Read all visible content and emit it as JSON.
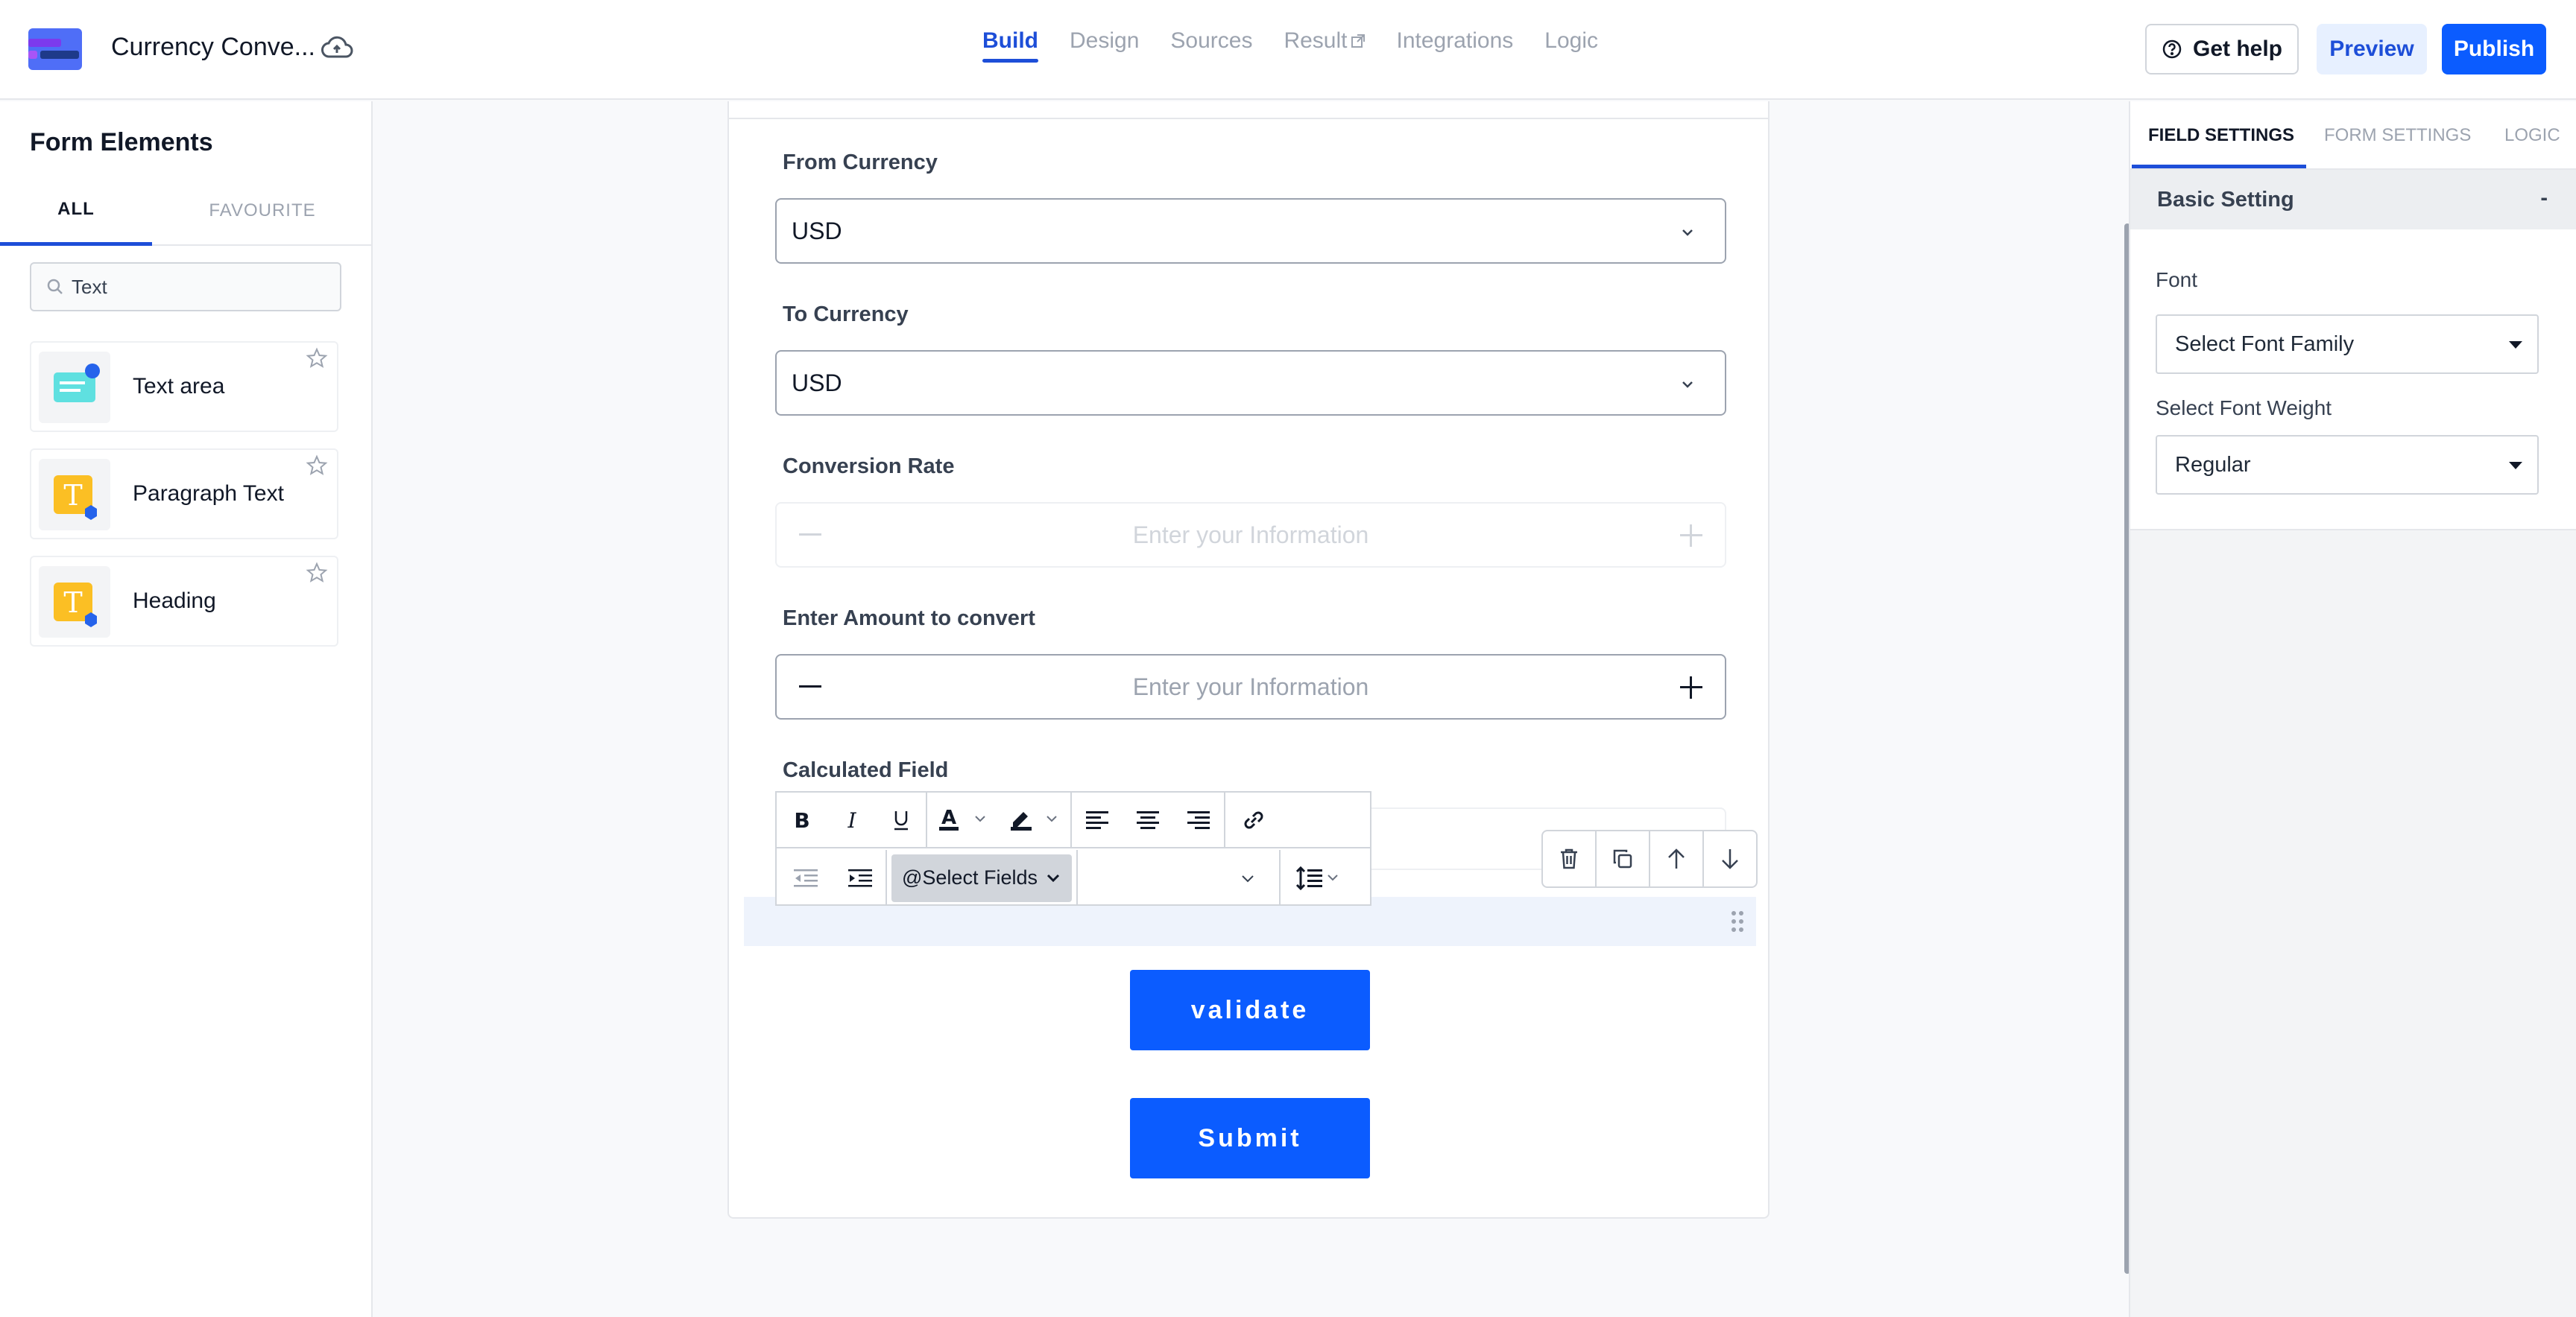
{
  "header": {
    "app_title": "Currency Conve...",
    "nav": [
      {
        "label": "Build",
        "active": true
      },
      {
        "label": "Design"
      },
      {
        "label": "Sources"
      },
      {
        "label": "Result"
      },
      {
        "label": "Integrations"
      },
      {
        "label": "Logic"
      }
    ],
    "get_help": "Get help",
    "preview": "Preview",
    "publish": "Publish",
    "accent_color": "#0b5cff"
  },
  "left_panel": {
    "title": "Form Elements",
    "tabs": [
      "ALL",
      "FAVOURITE"
    ],
    "search_value": "Text",
    "elements": [
      {
        "label": "Text area",
        "icon": "text-area-icon"
      },
      {
        "label": "Paragraph Text",
        "icon": "paragraph-text-icon"
      },
      {
        "label": "Heading",
        "icon": "heading-icon"
      }
    ]
  },
  "form": {
    "from_currency_label": "From Currency",
    "from_currency_value": "USD",
    "to_currency_label": "To Currency",
    "to_currency_value": "USD",
    "conversion_rate_label": "Conversion Rate",
    "conversion_rate_placeholder": "Enter your Information",
    "amount_label": "Enter Amount to convert",
    "amount_placeholder": "Enter your Information",
    "calculated_label": "Calculated Field",
    "select_fields": "@Select Fields",
    "validate": "validate",
    "submit": "Submit"
  },
  "right_panel": {
    "tabs": [
      "FIELD SETTINGS",
      "FORM SETTINGS",
      "LOGIC"
    ],
    "section": "Basic Setting",
    "collapse": "-",
    "font_label": "Font",
    "font_value": "Select Font Family",
    "weight_label": "Select Font Weight",
    "weight_value": "Regular"
  }
}
